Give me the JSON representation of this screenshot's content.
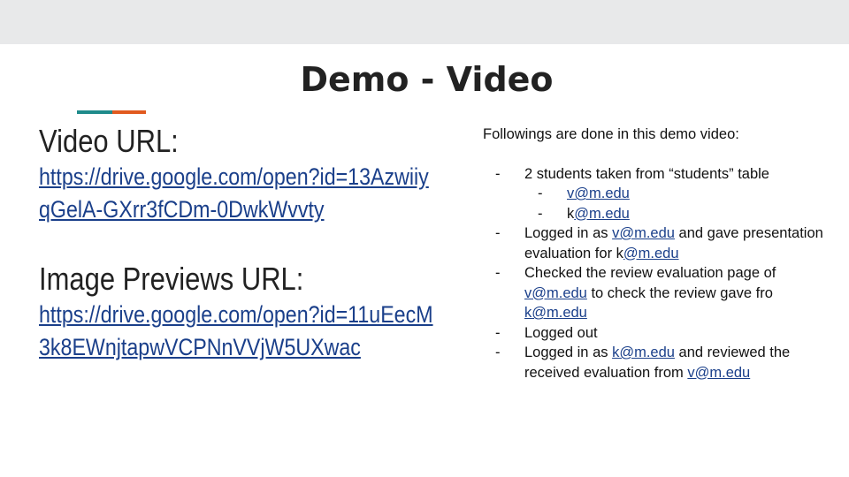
{
  "slide": {
    "title": "Demo - Video"
  },
  "accent": {
    "teal": "#1e8b8b",
    "orange": "#e15a1f"
  },
  "left": {
    "video_heading": "Video URL:",
    "video_url_line1": "https://drive.google.com/open?id=13Azwiiy",
    "video_url_line2": "qGelA-GXrr3fCDm-0DwkWvvty",
    "images_heading": "Image Previews URL:",
    "images_url_line1": "https://drive.google.com/open?id=11uEecM",
    "images_url_line2": "3k8EWnjtapwVCPNnVVjW5UXwac"
  },
  "right": {
    "intro": "Followings are done in this demo video:",
    "item1": "2 students taken from “students” table",
    "item1_sub1_link": "v@m.edu",
    "item1_sub2_prefix": "k",
    "item1_sub2_link": "@m.edu",
    "item2_a": "Logged in as ",
    "item2_link1": "v@m.edu",
    "item2_b": " and gave presentation evaluation for k",
    "item2_link2": "@m.edu",
    "item3_a": "Checked the review evaluation page of ",
    "item3_link1": "v@m.edu",
    "item3_b": " to check the review gave fro ",
    "item3_link2": "k@m.edu",
    "item4": "Logged out",
    "item5_a": "Logged in as ",
    "item5_link1": "k@m.edu",
    "item5_b": " and reviewed the received evaluation from ",
    "item5_link2": "v@m.edu"
  }
}
